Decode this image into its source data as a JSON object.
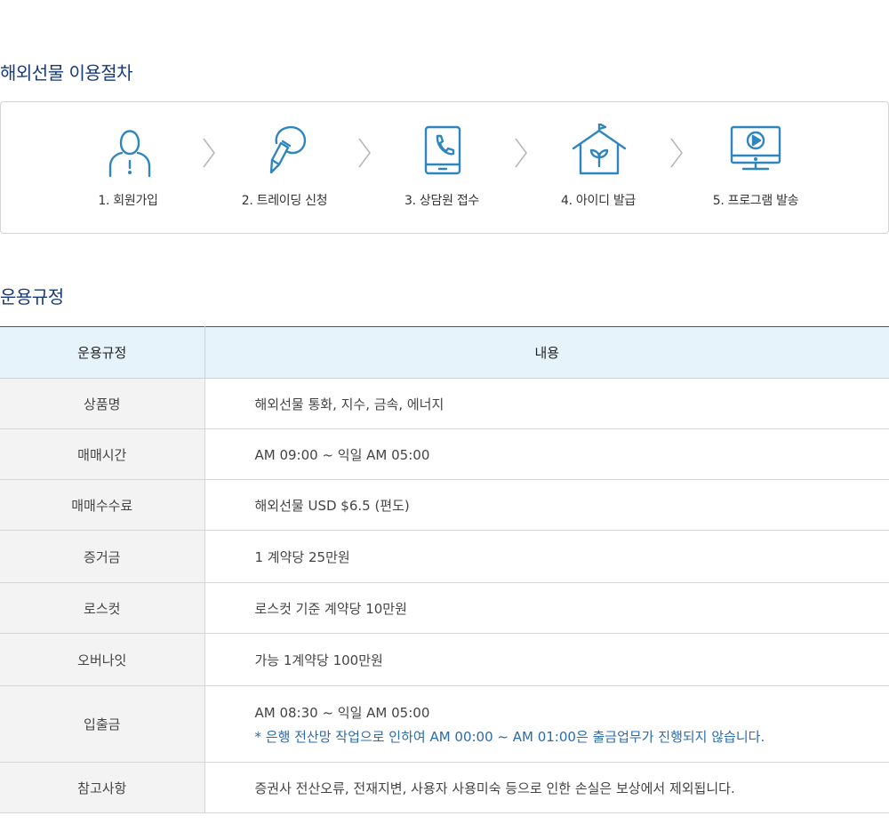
{
  "process": {
    "title": "해외선물 이용절차",
    "steps": [
      {
        "label": "1. 회원가입",
        "icon": "person-info-icon"
      },
      {
        "label": "2. 트레이딩 신청",
        "icon": "pen-bubble-icon"
      },
      {
        "label": "3. 상담원 접수",
        "icon": "phone-call-icon"
      },
      {
        "label": "4. 아이디 발급",
        "icon": "house-sprout-icon"
      },
      {
        "label": "5. 프로그램 발송",
        "icon": "monitor-play-icon"
      }
    ]
  },
  "rules": {
    "title": "운용규정",
    "headers": [
      "운용규정",
      "내용"
    ],
    "rows": [
      {
        "name": "상품명",
        "value": "해외선물 통화, 지수, 금속, 에너지"
      },
      {
        "name": "매매시간",
        "value": "AM 09:00 ~ 익일 AM 05:00"
      },
      {
        "name": "매매수수료",
        "value": "해외선물 USD $6.5 (편도)"
      },
      {
        "name": "증거금",
        "value": "1 계약당 25만원"
      },
      {
        "name": "로스컷",
        "value": "로스컷 기준 계약당 10만원"
      },
      {
        "name": "오버나잇",
        "value": "가능 1계약당 100만원"
      },
      {
        "name": "입출금",
        "value": "AM 08:30 ~ 익일 AM 05:00",
        "note": "* 은행 전산망 작업으로 인하여 AM 00:00 ~ AM 01:00은 출금업무가 진행되지 않습니다."
      },
      {
        "name": "참고사항",
        "value": "증권사 전산오류, 전재지변, 사용자 사용미숙 등으로 인한 손실은 보상에서 제외됩니다."
      }
    ]
  },
  "colors": {
    "title": "#173a7a",
    "icon": "#2f86bf",
    "header_bg": "#e6f3fb",
    "note": "#2b6cad"
  }
}
